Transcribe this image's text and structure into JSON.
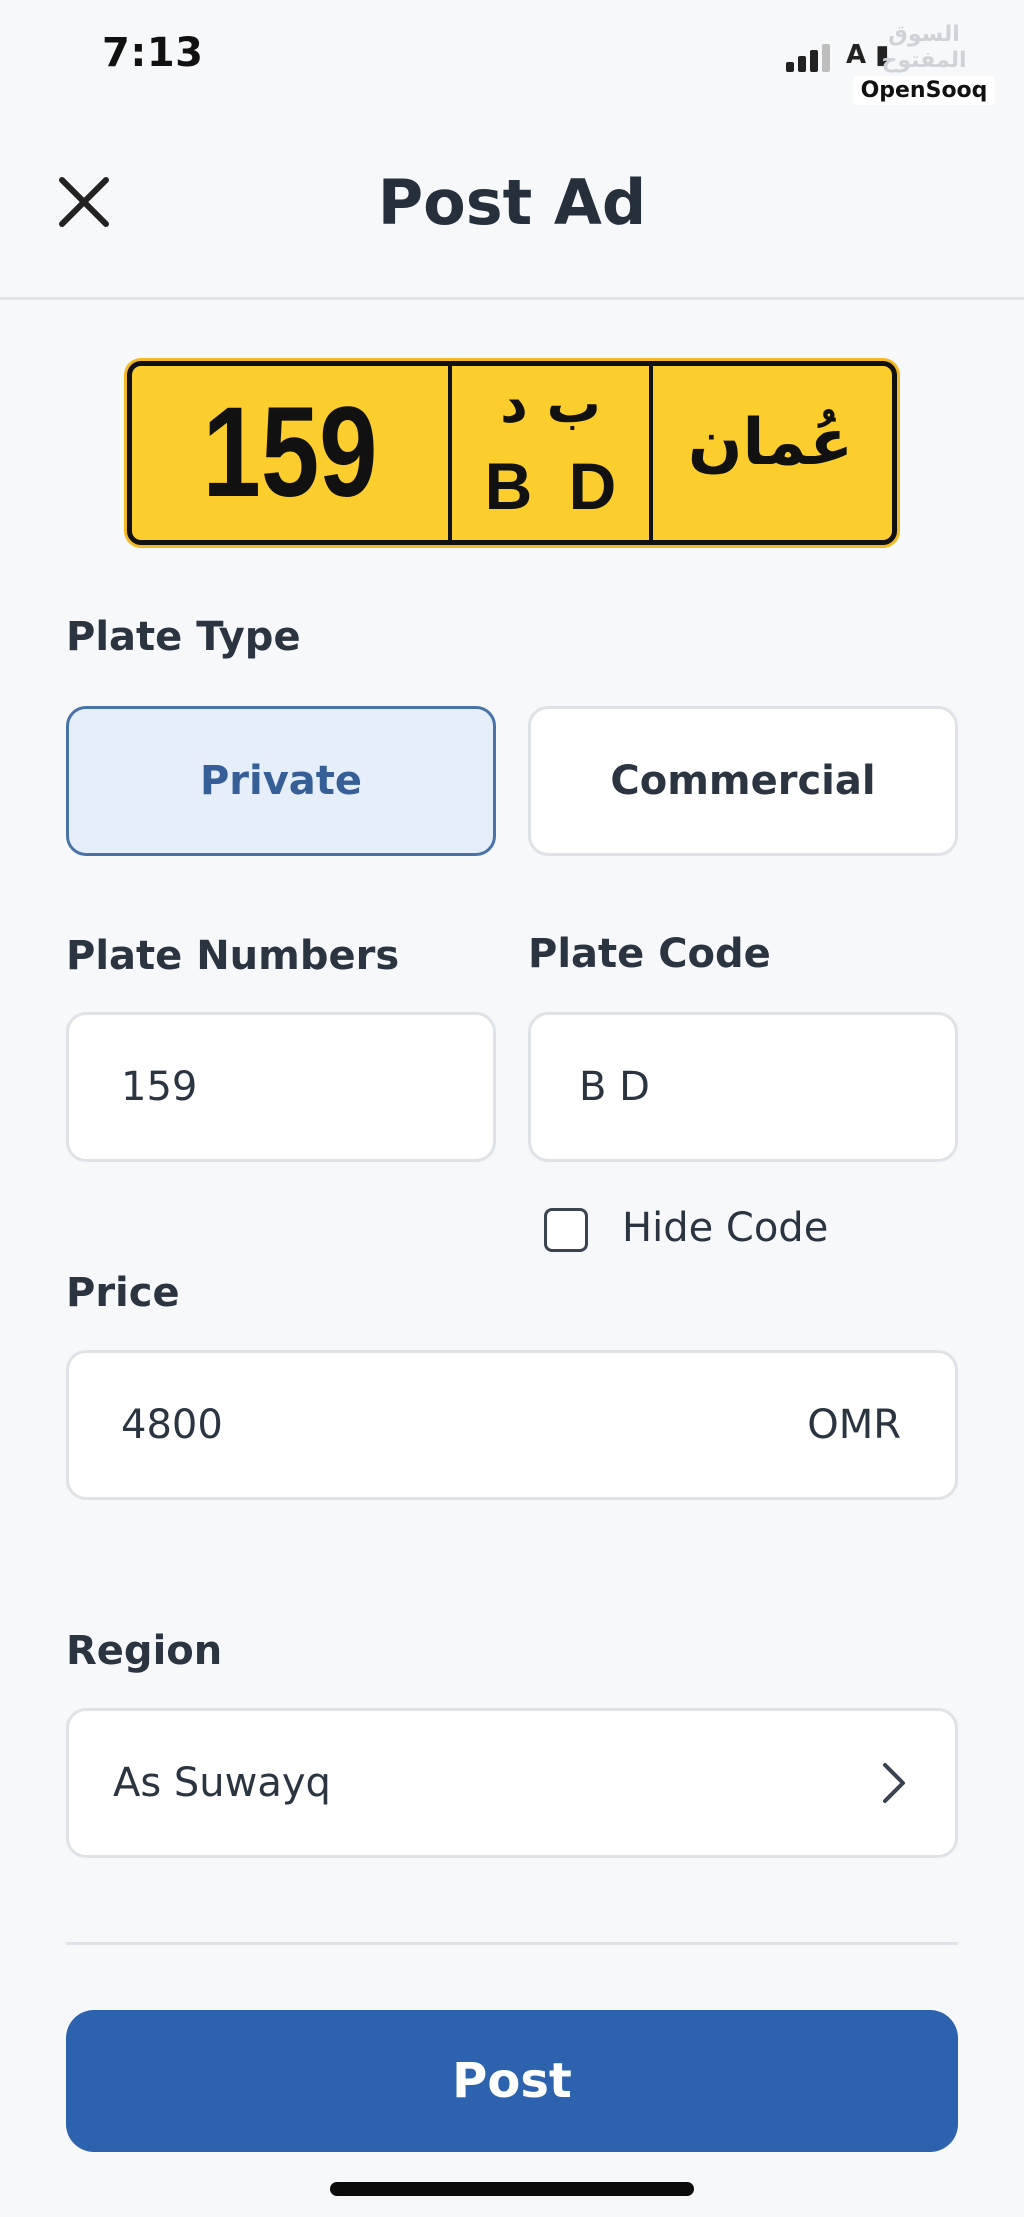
{
  "status_bar": {
    "time": "7:13",
    "glyphs": "ꓮ ▮"
  },
  "watermark": {
    "arabic": "السوق المفتوح",
    "brand": "OpenSooq"
  },
  "header": {
    "title": "Post Ad",
    "close_icon": "close-icon"
  },
  "plate": {
    "number": "159",
    "code_arabic": "ب د",
    "code_latin": "B D",
    "country_arabic": "عُمان",
    "background_color": "#fbcd2d"
  },
  "form": {
    "plate_type": {
      "label": "Plate Type",
      "options": [
        "Private",
        "Commercial"
      ],
      "selected": "Private"
    },
    "plate_numbers": {
      "label": "Plate Numbers",
      "value": "159"
    },
    "plate_code": {
      "label": "Plate Code",
      "value": "B D"
    },
    "hide_code": {
      "label": "Hide Code",
      "checked": false
    },
    "price": {
      "label": "Price",
      "value": "4800",
      "currency": "OMR"
    },
    "region": {
      "label": "Region",
      "value": "As Suwayq",
      "icon": "chevron-right-icon"
    }
  },
  "actions": {
    "post_label": "Post",
    "accent_color": "#2d63ae"
  }
}
